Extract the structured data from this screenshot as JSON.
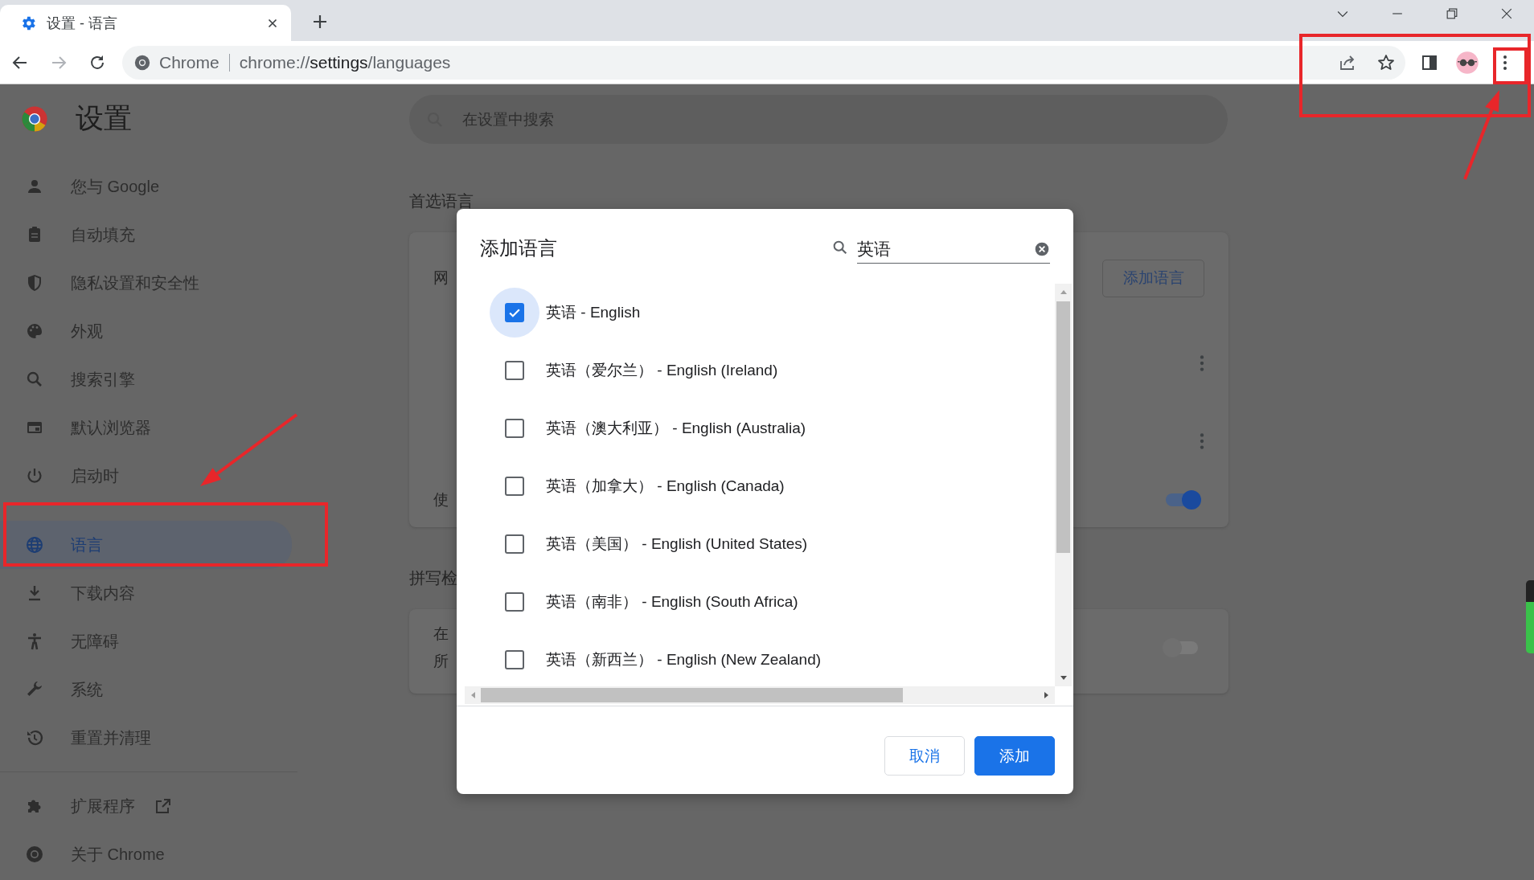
{
  "browser": {
    "tabs": [
      {
        "title": "设置 - 语言",
        "selected": true
      }
    ],
    "address_bar": {
      "site_label": "Chrome",
      "url": "chrome://**settings**/languages"
    }
  },
  "settings": {
    "title": "设置",
    "search": {
      "placeholder": "在设置中搜索"
    },
    "sidebar": {
      "groups": [
        {
          "items": [
            {
              "label": "您与 Google",
              "selected": false,
              "external": false
            },
            {
              "label": "自动填充",
              "selected": false,
              "external": false
            },
            {
              "label": "隐私设置和安全性",
              "selected": false,
              "external": false
            },
            {
              "label": "外观",
              "selected": false,
              "external": false
            },
            {
              "label": "搜索引擎",
              "selected": false,
              "external": false
            },
            {
              "label": "默认浏览器",
              "selected": false,
              "external": false
            },
            {
              "label": "启动时",
              "selected": false,
              "external": false
            }
          ]
        },
        {
          "items": [
            {
              "label": "语言",
              "selected": true,
              "external": false
            },
            {
              "label": "下载内容",
              "selected": false,
              "external": false
            },
            {
              "label": "无障碍",
              "selected": false,
              "external": false
            },
            {
              "label": "系统",
              "selected": false,
              "external": false
            },
            {
              "label": "重置并清理",
              "selected": false,
              "external": false
            }
          ]
        }
      ],
      "footer": {
        "items": [
          {
            "label": "扩展程序",
            "selected": false,
            "external": true
          },
          {
            "label": "关于 Chrome",
            "selected": false,
            "external": false
          }
        ]
      }
    },
    "sections": [
      {
        "heading": "首选语言",
        "rows": [
          {
            "kind": "button-row",
            "text": "网",
            "button": "添加语言"
          },
          {
            "kind": "menu-row"
          },
          {
            "kind": "menu-row"
          },
          {
            "kind": "toggle-row",
            "text": "使",
            "on": true
          }
        ]
      },
      {
        "heading": "拼写检",
        "rows": [
          {
            "kind": "toggle-row",
            "text": "在",
            "subtext": "所",
            "on": false
          }
        ]
      }
    ]
  },
  "dialog": {
    "title": "添加语言",
    "search": {
      "value": "英语"
    },
    "options": [
      {
        "label": "英语 - English",
        "checked": true,
        "focused": true
      },
      {
        "label": "英语（爱尔兰） - English (Ireland)",
        "checked": false,
        "focused": false
      },
      {
        "label": "英语（澳大利亚） - English (Australia)",
        "checked": false,
        "focused": false
      },
      {
        "label": "英语（加拿大） - English (Canada)",
        "checked": false,
        "focused": false
      },
      {
        "label": "英语（美国） - English (United States)",
        "checked": false,
        "focused": false
      },
      {
        "label": "英语（南非） - English (South Africa)",
        "checked": false,
        "focused": false
      },
      {
        "label": "英语（新西兰） - English (New Zealand)",
        "checked": false,
        "focused": false
      }
    ],
    "buttons": [
      {
        "label": "取消",
        "kind": "secondary"
      },
      {
        "label": "添加",
        "kind": "primary"
      }
    ]
  }
}
